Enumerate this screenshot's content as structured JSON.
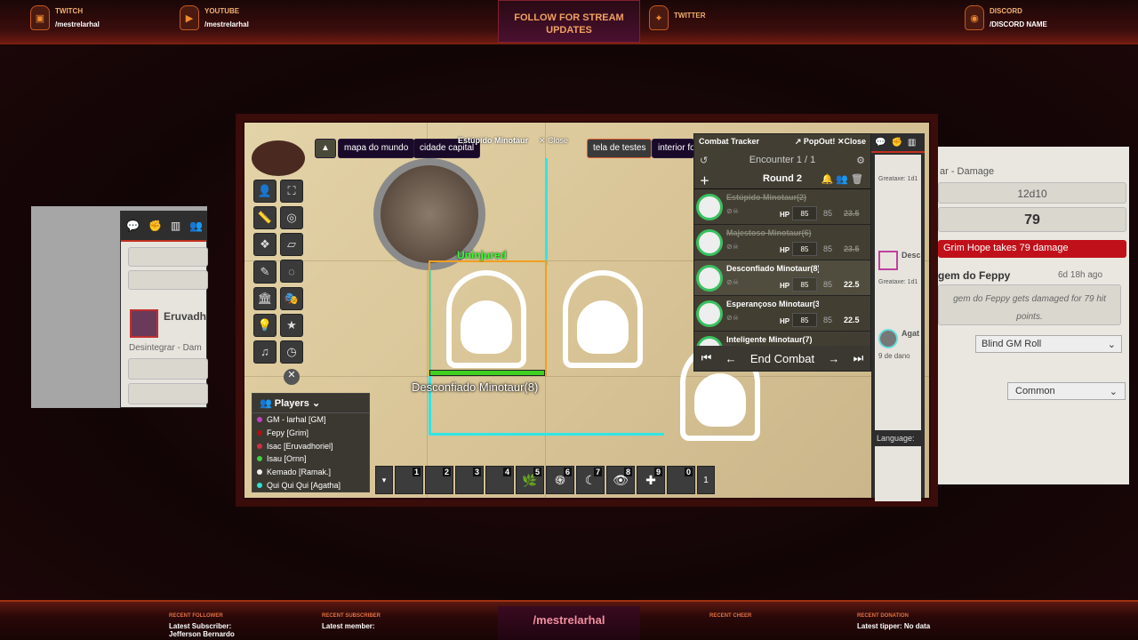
{
  "overlay": {
    "social": [
      {
        "icon": "twitch-icon",
        "title": "TWITCH",
        "value": "/mestrelarhal"
      },
      {
        "icon": "youtube-icon",
        "title": "YOUTUBE",
        "value": "/mestrelarhal"
      },
      {
        "icon": "twitter-icon",
        "title": "TWITTER",
        "value": ""
      },
      {
        "icon": "discord-icon",
        "title": "DISCORD",
        "value": "/DISCORD NAME"
      }
    ],
    "follow": "FOLLOW FOR STREAM UPDATES",
    "channel": "/mestrelarhal",
    "stats": [
      {
        "title": "RECENT FOLLOWER",
        "value": "Latest Subscriber: Jefferson Bernardo"
      },
      {
        "title": "RECENT SUBSCRIBER",
        "value": "Latest member:"
      },
      {
        "title": "RECENT CHEER",
        "value": ""
      },
      {
        "title": "RECENT DONATION",
        "value": "Latest tipper: No data"
      }
    ]
  },
  "scene_nav": {
    "items": [
      "mapa do mundo",
      "cidade capital",
      "Estúpido Minotaur",
      "✕ Close",
      "tela de testes",
      "interior fo"
    ]
  },
  "map": {
    "health_label": "Uninjured",
    "token_label": "Desconfiado Minotaur(8)",
    "accent": "#2ee6e6"
  },
  "players": {
    "title": "Players",
    "list": [
      {
        "name": "GM - larhal [GM]",
        "color": "#c040c0"
      },
      {
        "name": "Fepy [Grim]",
        "color": "#b01010"
      },
      {
        "name": "Isac [Eruvadhoriel]",
        "color": "#d03040"
      },
      {
        "name": "Isau [Ornn]",
        "color": "#40d040"
      },
      {
        "name": "Kemado [Ramak.]",
        "color": "#eeeeee"
      },
      {
        "name": "Qui Qui Qui [Agatha]",
        "color": "#30e0d0"
      }
    ]
  },
  "hotbar": {
    "slots": [
      "1",
      "2",
      "3",
      "4",
      "5",
      "6",
      "7",
      "8",
      "9",
      "0"
    ],
    "page": "1"
  },
  "combat": {
    "title": "Combat Tracker",
    "popout": "PopOut!",
    "close": "Close",
    "encounter": "Encounter 1 / 1",
    "round": "Round 2",
    "hp_label": "HP",
    "combatants": [
      {
        "name": "Estúpido Minotaur(2)",
        "hp": "85",
        "max": "85",
        "init": "23.5",
        "defeated": true
      },
      {
        "name": "Majestoso Minotaur(6)",
        "hp": "85",
        "max": "85",
        "init": "23.5",
        "defeated": true
      },
      {
        "name": "Desconfiado Minotaur(8)",
        "hp": "85",
        "max": "85",
        "init": "22.5",
        "defeated": false
      },
      {
        "name": "Esperançoso Minotaur(3)",
        "hp": "85",
        "max": "85",
        "init": "22.5",
        "defeated": false
      },
      {
        "name": "Inteligente Minotaur(7)",
        "hp": "",
        "max": "",
        "init": "",
        "defeated": false
      }
    ],
    "end": "End Combat"
  },
  "sidebar": {
    "card1": "Greataxe: 1d1",
    "card2_name": "Desc",
    "card2": "Greataxe: 1d1",
    "card3_name": "Agat",
    "card3": "9 de dano",
    "language": "Language:"
  },
  "chat": {
    "dmg_label": "ar - Damage",
    "formula": "12d10",
    "total": "79",
    "banner": "Grim Hope takes 79 damage",
    "msg_name": "gem do Feppy",
    "msg_time": "6d 18h ago",
    "msg_text": "gem do Feppy gets damaged for 79 hit points.",
    "roll_mode": "Blind GM Roll",
    "language": "Common",
    "banner_color": "#c0101a"
  },
  "left_chat": {
    "name": "Eruvadh",
    "text": "Desintegrar - Dam"
  }
}
